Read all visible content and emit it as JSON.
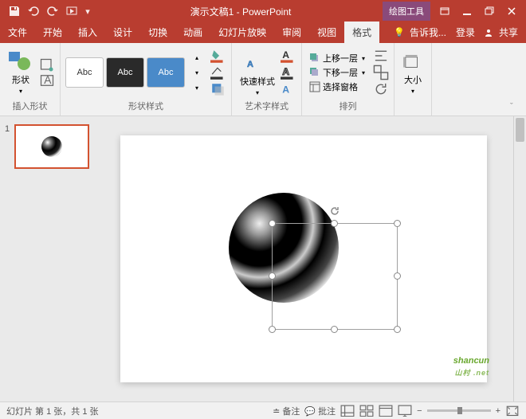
{
  "titlebar": {
    "title": "演示文稿1 - PowerPoint",
    "contextTab": "绘图工具"
  },
  "tabs": {
    "file": "文件",
    "home": "开始",
    "insert": "插入",
    "design": "设计",
    "transitions": "切换",
    "animations": "动画",
    "slideshow": "幻灯片放映",
    "review": "审阅",
    "view": "视图",
    "format": "格式",
    "tellme": "告诉我...",
    "signin": "登录",
    "share": "共享"
  },
  "ribbon": {
    "insertShape": {
      "label": "插入形状",
      "btn": "形状"
    },
    "shapeStyles": {
      "label": "形状样式",
      "sample": "Abc"
    },
    "quickStyles": {
      "btn": "快速样式"
    },
    "wordArt": {
      "label": "艺术字样式"
    },
    "arrange": {
      "label": "排列",
      "bringForward": "上移一层",
      "sendBackward": "下移一层",
      "selectionPane": "选择窗格"
    },
    "size": {
      "label": "大小"
    }
  },
  "thumbnail": {
    "num": "1"
  },
  "statusbar": {
    "slideInfo": "幻灯片 第 1 张，共 1 张",
    "notes": "备注",
    "comments": "批注"
  },
  "watermark": {
    "text": "shancun",
    "sub": "山村 .net"
  }
}
